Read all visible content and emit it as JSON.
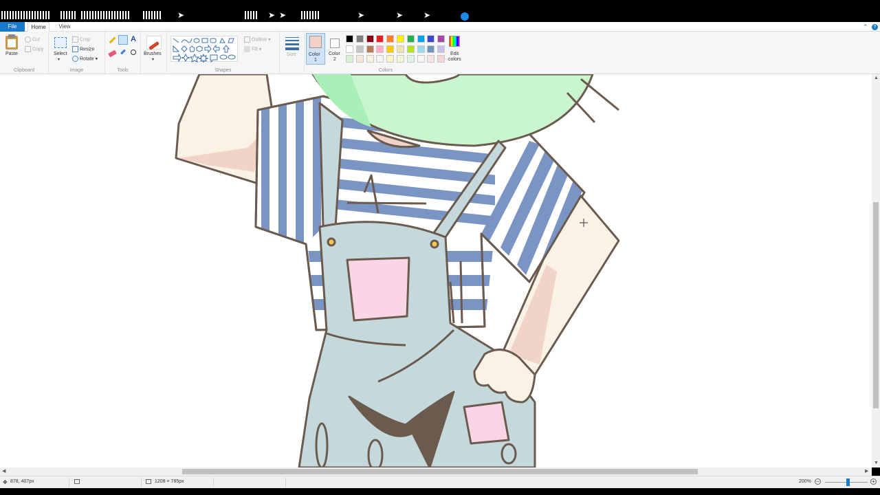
{
  "ribbon_tabs": {
    "file": "File",
    "home": "Home",
    "view": "View"
  },
  "clipboard": {
    "paste": "Paste",
    "cut": "Cut",
    "copy": "Copy",
    "label": "Clipboard"
  },
  "image": {
    "select": "Select",
    "crop": "Crop",
    "resize": "Resize",
    "rotate": "Rotate",
    "label": "Image"
  },
  "tools": {
    "label": "Tools",
    "text_glyph": "A"
  },
  "brushes": {
    "label": "Brushes"
  },
  "shapes": {
    "outline": "Outline",
    "fill": "Fill",
    "label": "Shapes"
  },
  "size": {
    "label": "Size"
  },
  "colors": {
    "color1_l1": "Color",
    "color1_l2": "1",
    "color2_l1": "Color",
    "color2_l2": "2",
    "edit_l1": "Edit",
    "edit_l2": "colors",
    "label": "Colors",
    "color1": "#f3d2c8",
    "color2": "#ffffff",
    "palette_row1": [
      "#000000",
      "#7f7f7f",
      "#880015",
      "#ed1c24",
      "#ff7f27",
      "#fff200",
      "#22b14c",
      "#00a2e8",
      "#3f48cc",
      "#a349a4"
    ],
    "palette_row2": [
      "#ffffff",
      "#c3c3c3",
      "#b97a57",
      "#ffaec9",
      "#ffc90e",
      "#efe4b0",
      "#b5e61d",
      "#99d9ea",
      "#7092be",
      "#c8bfe7"
    ],
    "palette_row3": [
      "#d8f0d2",
      "#f6e7dc",
      "#fbefe2",
      "#f3f3f3",
      "#fff3c4",
      "#f0f8d8",
      "#e0f4e4",
      "#f8f6ee",
      "#f5e4e2",
      "#f2d8d0"
    ]
  },
  "status": {
    "cursor_pos": "878, 407px",
    "image_size": "1208 × 785px",
    "zoom": "200%"
  },
  "icons": {
    "paste": "clipboard-icon",
    "select": "select-icon",
    "brushes": "brush-icon"
  }
}
